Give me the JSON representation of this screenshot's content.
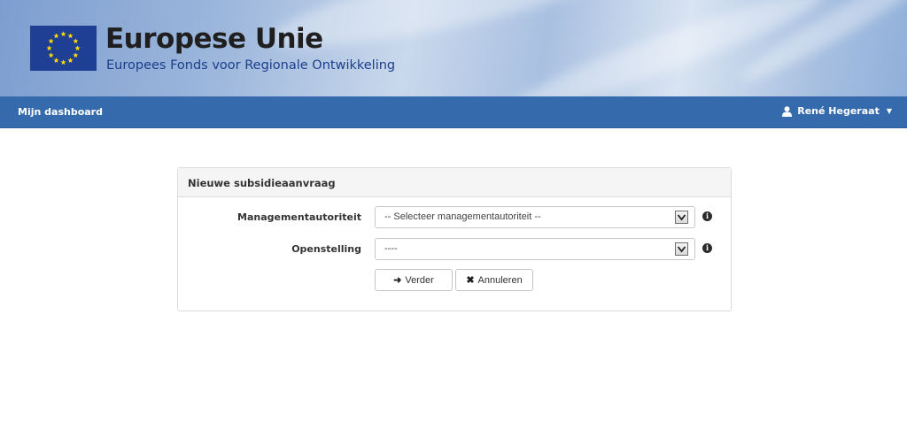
{
  "header": {
    "logo_icon": "eu-flag-icon",
    "title": "Europese Unie",
    "subtitle": "Europees Fonds voor Regionale Ontwikkeling"
  },
  "navbar": {
    "dashboard_label": "Mijn dashboard",
    "user_name": "René Hegeraat",
    "user_icon": "user-icon",
    "caret_icon": "caret-down-icon"
  },
  "panel": {
    "title": "Nieuwe subsidieaanvraag",
    "fields": [
      {
        "label": "Managementautoriteit",
        "value": "-- Selecteer managementautoriteit --"
      },
      {
        "label": "Openstelling",
        "value": "----"
      }
    ],
    "buttons": {
      "next_label": "Verder",
      "cancel_label": "Annuleren"
    }
  },
  "colors": {
    "navbar": "#356aad",
    "flag": "#1e3f94",
    "stars": "#ffdd00"
  }
}
